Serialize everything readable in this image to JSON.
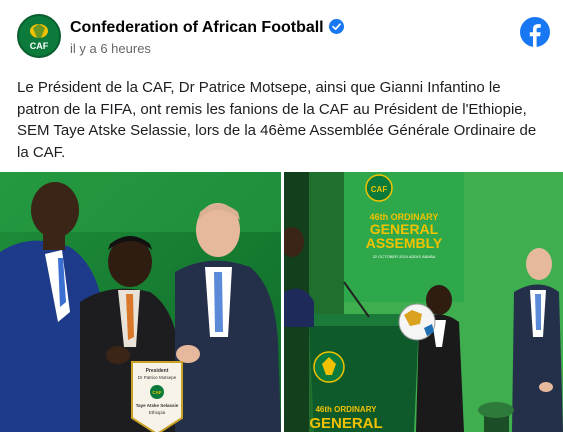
{
  "post": {
    "author": "Confederation of African Football",
    "timestamp": "il y a 6 heures",
    "text": "Le Président de la CAF, Dr Patrice Motsepe, ainsi que Gianni Infantino le patron de la FIFA, ont remis les fanions de la CAF au Président de l'Ethiopie, SEM Taye Atske Selassie, lors de la 46ème Assemblée Générale Ordinaire de la CAF."
  },
  "avatar": {
    "logo_text": "CAF"
  },
  "icons": {
    "verified": "verified-badge-icon",
    "platform": "facebook-logo-icon"
  },
  "photos": {
    "left": {
      "pennant_lines": [
        "President",
        "Dr Patrice Motsepe",
        "CAF",
        "Taye Atske Selassie",
        "Ethiopia"
      ]
    },
    "right": {
      "banner_logo": "CAF",
      "banner_sup": "46th ORDINARY",
      "banner_line1": "GENERAL",
      "banner_line2": "ASSEMBLY",
      "banner_small": "22 OCTOBER 2024 ADDIS ABABA",
      "podium_sup": "46th ORDINARY",
      "podium_line1": "GENERAL"
    }
  },
  "colors": {
    "facebook_blue": "#1877f2",
    "caf_green": "#0b7a3b",
    "banner_green": "#2ea84a"
  }
}
